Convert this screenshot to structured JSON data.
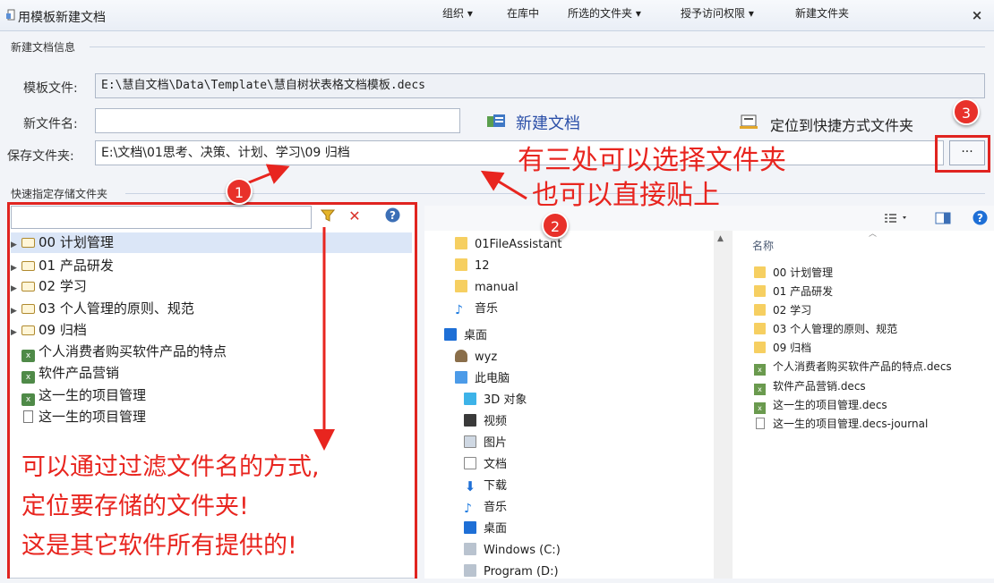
{
  "window": {
    "title": "用模板新建文档",
    "close_glyph": "×"
  },
  "info_group": {
    "label": "新建文档信息",
    "template_label": "模板文件:",
    "template_value": "E:\\慧自文档\\Data\\Template\\慧自树状表格文档模板.decs",
    "filename_label": "新文件名:",
    "filename_value": "",
    "create_button": "新建文档",
    "locate_button": "定位到快捷方式文件夹",
    "save_label": "保存文件夹:",
    "save_value": "E:\\文档\\01思考、决策、计划、学习\\09 归档",
    "browse_button": "···"
  },
  "quick_group": {
    "label": "快速指定存储文件夹",
    "filter_value": ""
  },
  "tree": [
    {
      "label": "00 计划管理",
      "type": "folder"
    },
    {
      "label": "01 产品研发",
      "type": "folder"
    },
    {
      "label": "02 学习",
      "type": "folder"
    },
    {
      "label": "03 个人管理的原则、规范",
      "type": "folder"
    },
    {
      "label": "09 归档",
      "type": "folder"
    },
    {
      "label": "个人消费者购买软件产品的特点",
      "type": "decs"
    },
    {
      "label": "软件产品营销",
      "type": "decs"
    },
    {
      "label": "这一生的项目管理",
      "type": "decs"
    },
    {
      "label": "这一生的项目管理",
      "type": "file"
    }
  ],
  "explorer": {
    "toolbar": {
      "organize": "组织 ▾",
      "include_in_library": "在库中",
      "selected_folder": "所选的文件夹 ▾",
      "grant_access": "授予访问权限 ▾",
      "new_folder": "新建文件夹"
    },
    "nav": [
      {
        "label": "01FileAssistant",
        "icon": "folder-icon"
      },
      {
        "label": "12",
        "icon": "folder-icon"
      },
      {
        "label": "manual",
        "icon": "folder-icon"
      },
      {
        "label": "音乐",
        "icon": "music-icon"
      },
      {
        "label": "桌面",
        "icon": "desktop-icon"
      },
      {
        "label": "wyz",
        "icon": "user-icon"
      },
      {
        "label": "此电脑",
        "icon": "computer-icon"
      },
      {
        "label": "3D 对象",
        "icon": "cube-icon"
      },
      {
        "label": "视频",
        "icon": "video-icon"
      },
      {
        "label": "图片",
        "icon": "picture-icon"
      },
      {
        "label": "文档",
        "icon": "document-icon"
      },
      {
        "label": "下载",
        "icon": "download-icon"
      },
      {
        "label": "音乐",
        "icon": "music-icon"
      },
      {
        "label": "桌面",
        "icon": "desktop-icon"
      },
      {
        "label": "Windows (C:)",
        "icon": "drive-icon"
      },
      {
        "label": "Program (D:)",
        "icon": "drive-icon"
      }
    ],
    "column_header": "名称",
    "files": [
      {
        "label": "00 计划管理",
        "type": "folder"
      },
      {
        "label": "01 产品研发",
        "type": "folder"
      },
      {
        "label": "02 学习",
        "type": "folder"
      },
      {
        "label": "03 个人管理的原则、规范",
        "type": "folder"
      },
      {
        "label": "09 归档",
        "type": "folder"
      },
      {
        "label": "个人消费者购买软件产品的特点.decs",
        "type": "decs"
      },
      {
        "label": "软件产品营销.decs",
        "type": "decs"
      },
      {
        "label": "这一生的项目管理.decs",
        "type": "decs"
      },
      {
        "label": "这一生的项目管理.decs-journal",
        "type": "file"
      }
    ]
  },
  "annotations": {
    "badges": [
      "1",
      "2",
      "3"
    ],
    "text_top_1": "有三处可以选择文件夹",
    "text_top_2": "也可以直接贴上",
    "text_bottom_1": "可以通过过滤文件名的方式,",
    "text_bottom_2": "定位要存储的文件夹!",
    "text_bottom_3": "这是其它软件所有提供的!",
    "color": "#e8251f"
  }
}
